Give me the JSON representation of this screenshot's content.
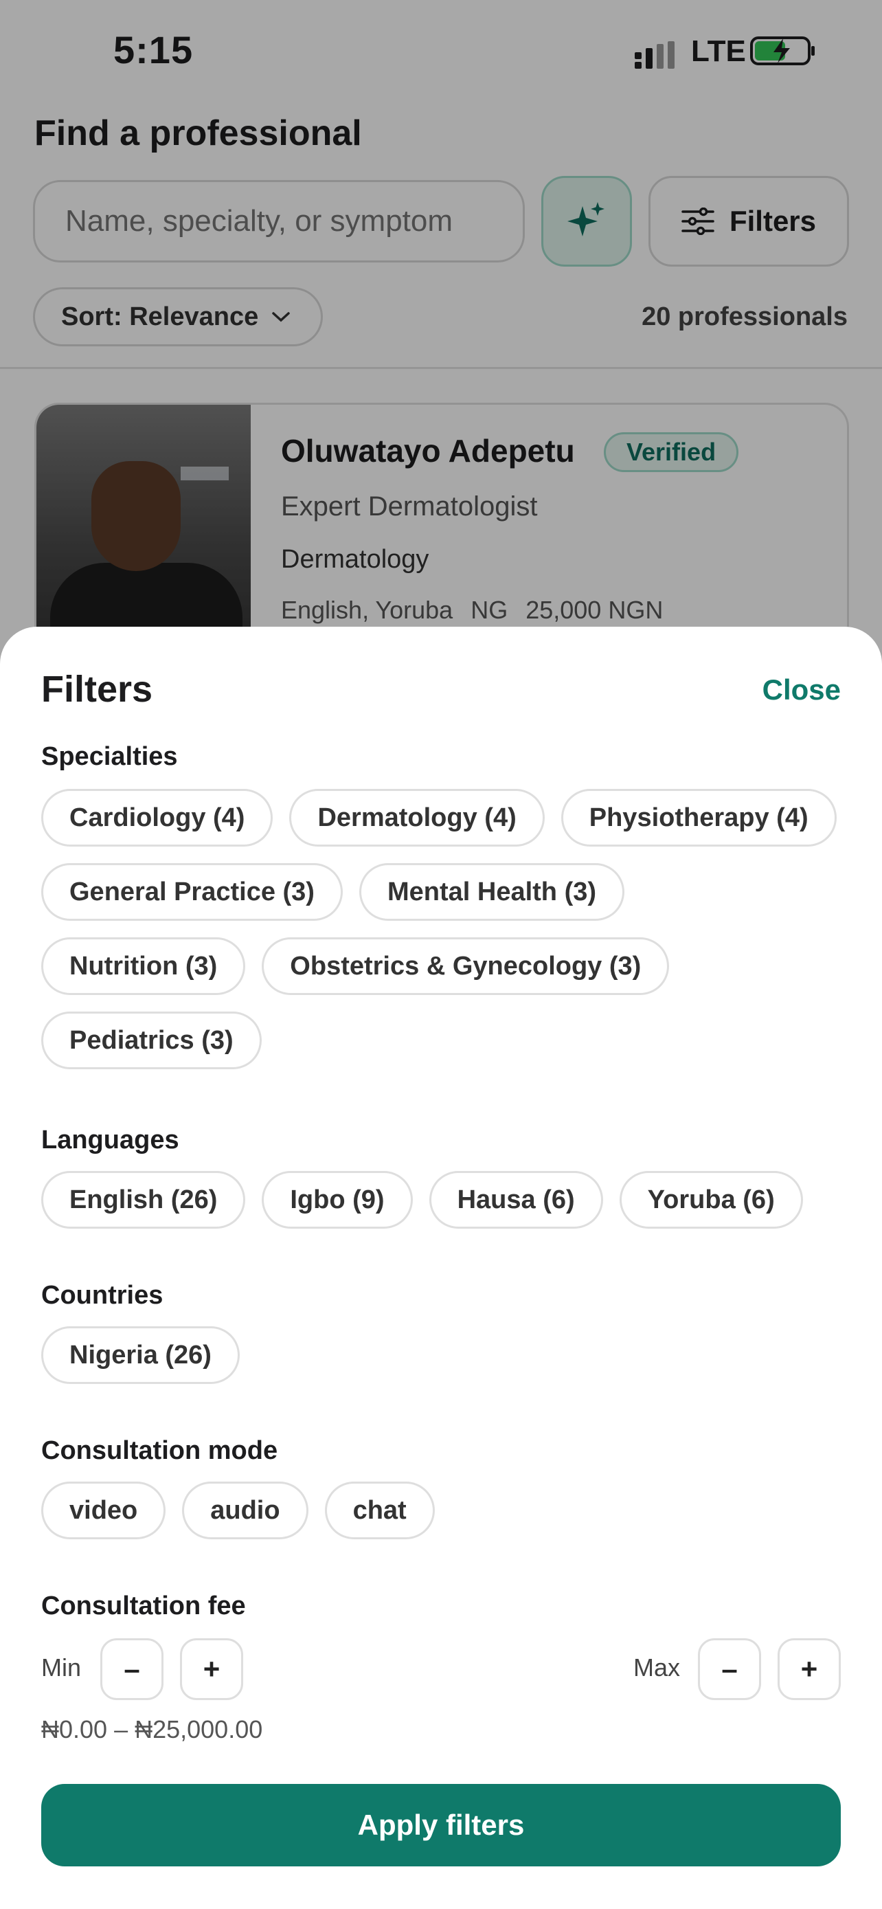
{
  "status": {
    "time": "5:15",
    "network": "LTE"
  },
  "header": {
    "title": "Find a professional"
  },
  "search": {
    "placeholder": "Name, specialty, or symptom"
  },
  "toolbar": {
    "filters_label": "Filters",
    "sort_label": "Sort: Relevance",
    "results_count": "20 professionals"
  },
  "card": {
    "name": "Oluwatayo Adepetu",
    "badge": "Verified",
    "title": "Expert Dermatologist",
    "specialty": "Dermatology",
    "languages": "English, Yoruba",
    "country": "NG",
    "fee": "25,000 NGN"
  },
  "sheet": {
    "title": "Filters",
    "close_label": "Close",
    "specialties_label": "Specialties",
    "specialties": [
      "Cardiology (4)",
      "Dermatology (4)",
      "Physiotherapy (4)",
      "General Practice (3)",
      "Mental Health (3)",
      "Nutrition (3)",
      "Obstetrics & Gynecology (3)",
      "Pediatrics (3)"
    ],
    "languages_label": "Languages",
    "languages": [
      "English (26)",
      "Igbo (9)",
      "Hausa (6)",
      "Yoruba (6)"
    ],
    "countries_label": "Countries",
    "countries": [
      "Nigeria (26)"
    ],
    "mode_label": "Consultation mode",
    "modes": [
      "video",
      "audio",
      "chat"
    ],
    "fee_label": "Consultation fee",
    "min_label": "Min",
    "max_label": "Max",
    "minus": "–",
    "plus": "+",
    "fee_range": "₦0.00 – ₦25,000.00",
    "apply_label": "Apply filters"
  },
  "colors": {
    "accent": "#0f7a6a",
    "overlay": "rgba(0,0,0,0.34)"
  }
}
